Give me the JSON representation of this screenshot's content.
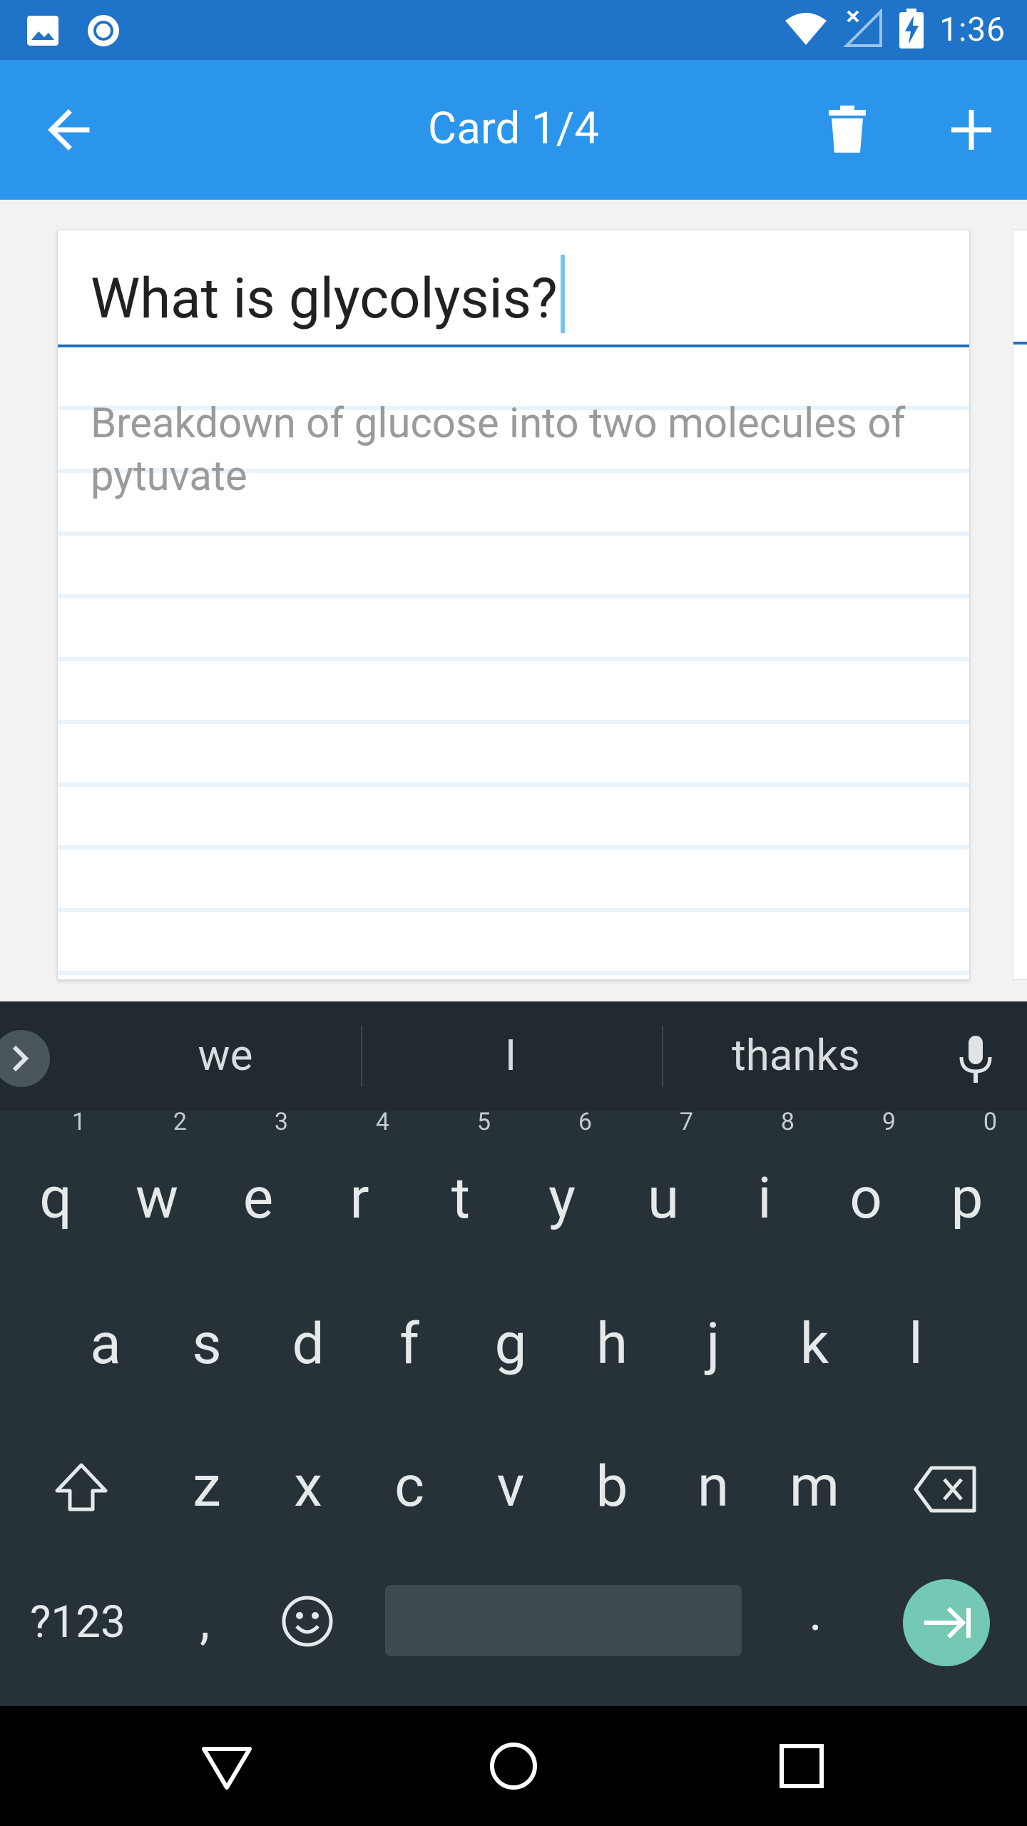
{
  "status_bar": {
    "time": "1:36",
    "icons": [
      "image-icon",
      "record-icon",
      "wifi-icon",
      "signal-off-icon",
      "battery-charging-icon"
    ]
  },
  "app_bar": {
    "title": "Card 1/4",
    "back_icon": "arrow-left-icon",
    "delete_icon": "trash-icon",
    "add_icon": "plus-icon"
  },
  "card": {
    "question": "What is glycolysis?",
    "answer": "Breakdown of glucose into two molecules of pytuvate"
  },
  "keyboard": {
    "suggestions": [
      "we",
      "I",
      "thanks"
    ],
    "row1": [
      {
        "key": "q",
        "hint": "1"
      },
      {
        "key": "w",
        "hint": "2"
      },
      {
        "key": "e",
        "hint": "3"
      },
      {
        "key": "r",
        "hint": "4"
      },
      {
        "key": "t",
        "hint": "5"
      },
      {
        "key": "y",
        "hint": "6"
      },
      {
        "key": "u",
        "hint": "7"
      },
      {
        "key": "i",
        "hint": "8"
      },
      {
        "key": "o",
        "hint": "9"
      },
      {
        "key": "p",
        "hint": "0"
      }
    ],
    "row2": [
      "a",
      "s",
      "d",
      "f",
      "g",
      "h",
      "j",
      "k",
      "l"
    ],
    "row3": [
      "z",
      "x",
      "c",
      "v",
      "b",
      "n",
      "m"
    ],
    "symbols_label": "?123",
    "comma": ",",
    "period": ".",
    "accent_color": "#73c9b4"
  },
  "nav_bar": {
    "icons": [
      "back-triangle-icon",
      "home-circle-icon",
      "recents-square-icon"
    ]
  }
}
